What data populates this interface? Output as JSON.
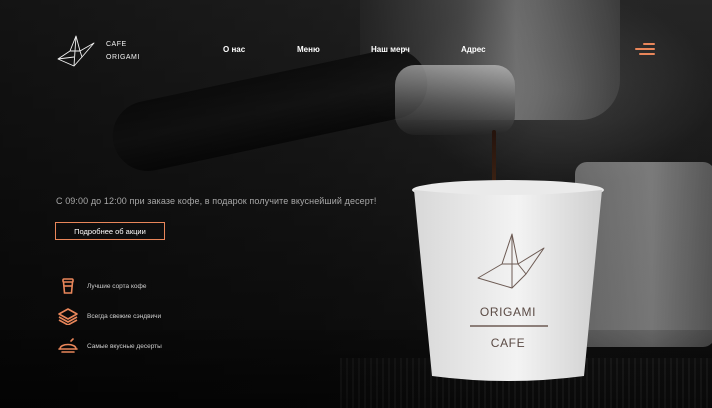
{
  "brand": {
    "logo_icon": "origami-crane-icon",
    "line1": "CAFE",
    "line2": "ORIGAMI"
  },
  "nav": {
    "items": [
      "О нас",
      "Меню",
      "Наш мерч",
      "Адрес"
    ],
    "menu_icon": "hamburger-menu-icon"
  },
  "hero": {
    "promo_text": "С 09:00 до 12:00 при заказе кофе, в подарок получите вкуснейший десерт!",
    "cta_label": "Подробнее об акции"
  },
  "features": [
    {
      "icon": "coffee-cup-icon",
      "label": "Лучшие сорта кофе"
    },
    {
      "icon": "sandwich-icon",
      "label": "Всегда свежие сэндвичи"
    },
    {
      "icon": "dessert-icon",
      "label": "Самые вкусные десерты"
    }
  ],
  "cup": {
    "logo_icon": "origami-crane-icon",
    "line1": "ORIGAMI",
    "line2": "CAFE"
  },
  "colors": {
    "accent": "#e9865a",
    "text_primary": "#ffffff",
    "text_muted": "#a8a8a8"
  }
}
